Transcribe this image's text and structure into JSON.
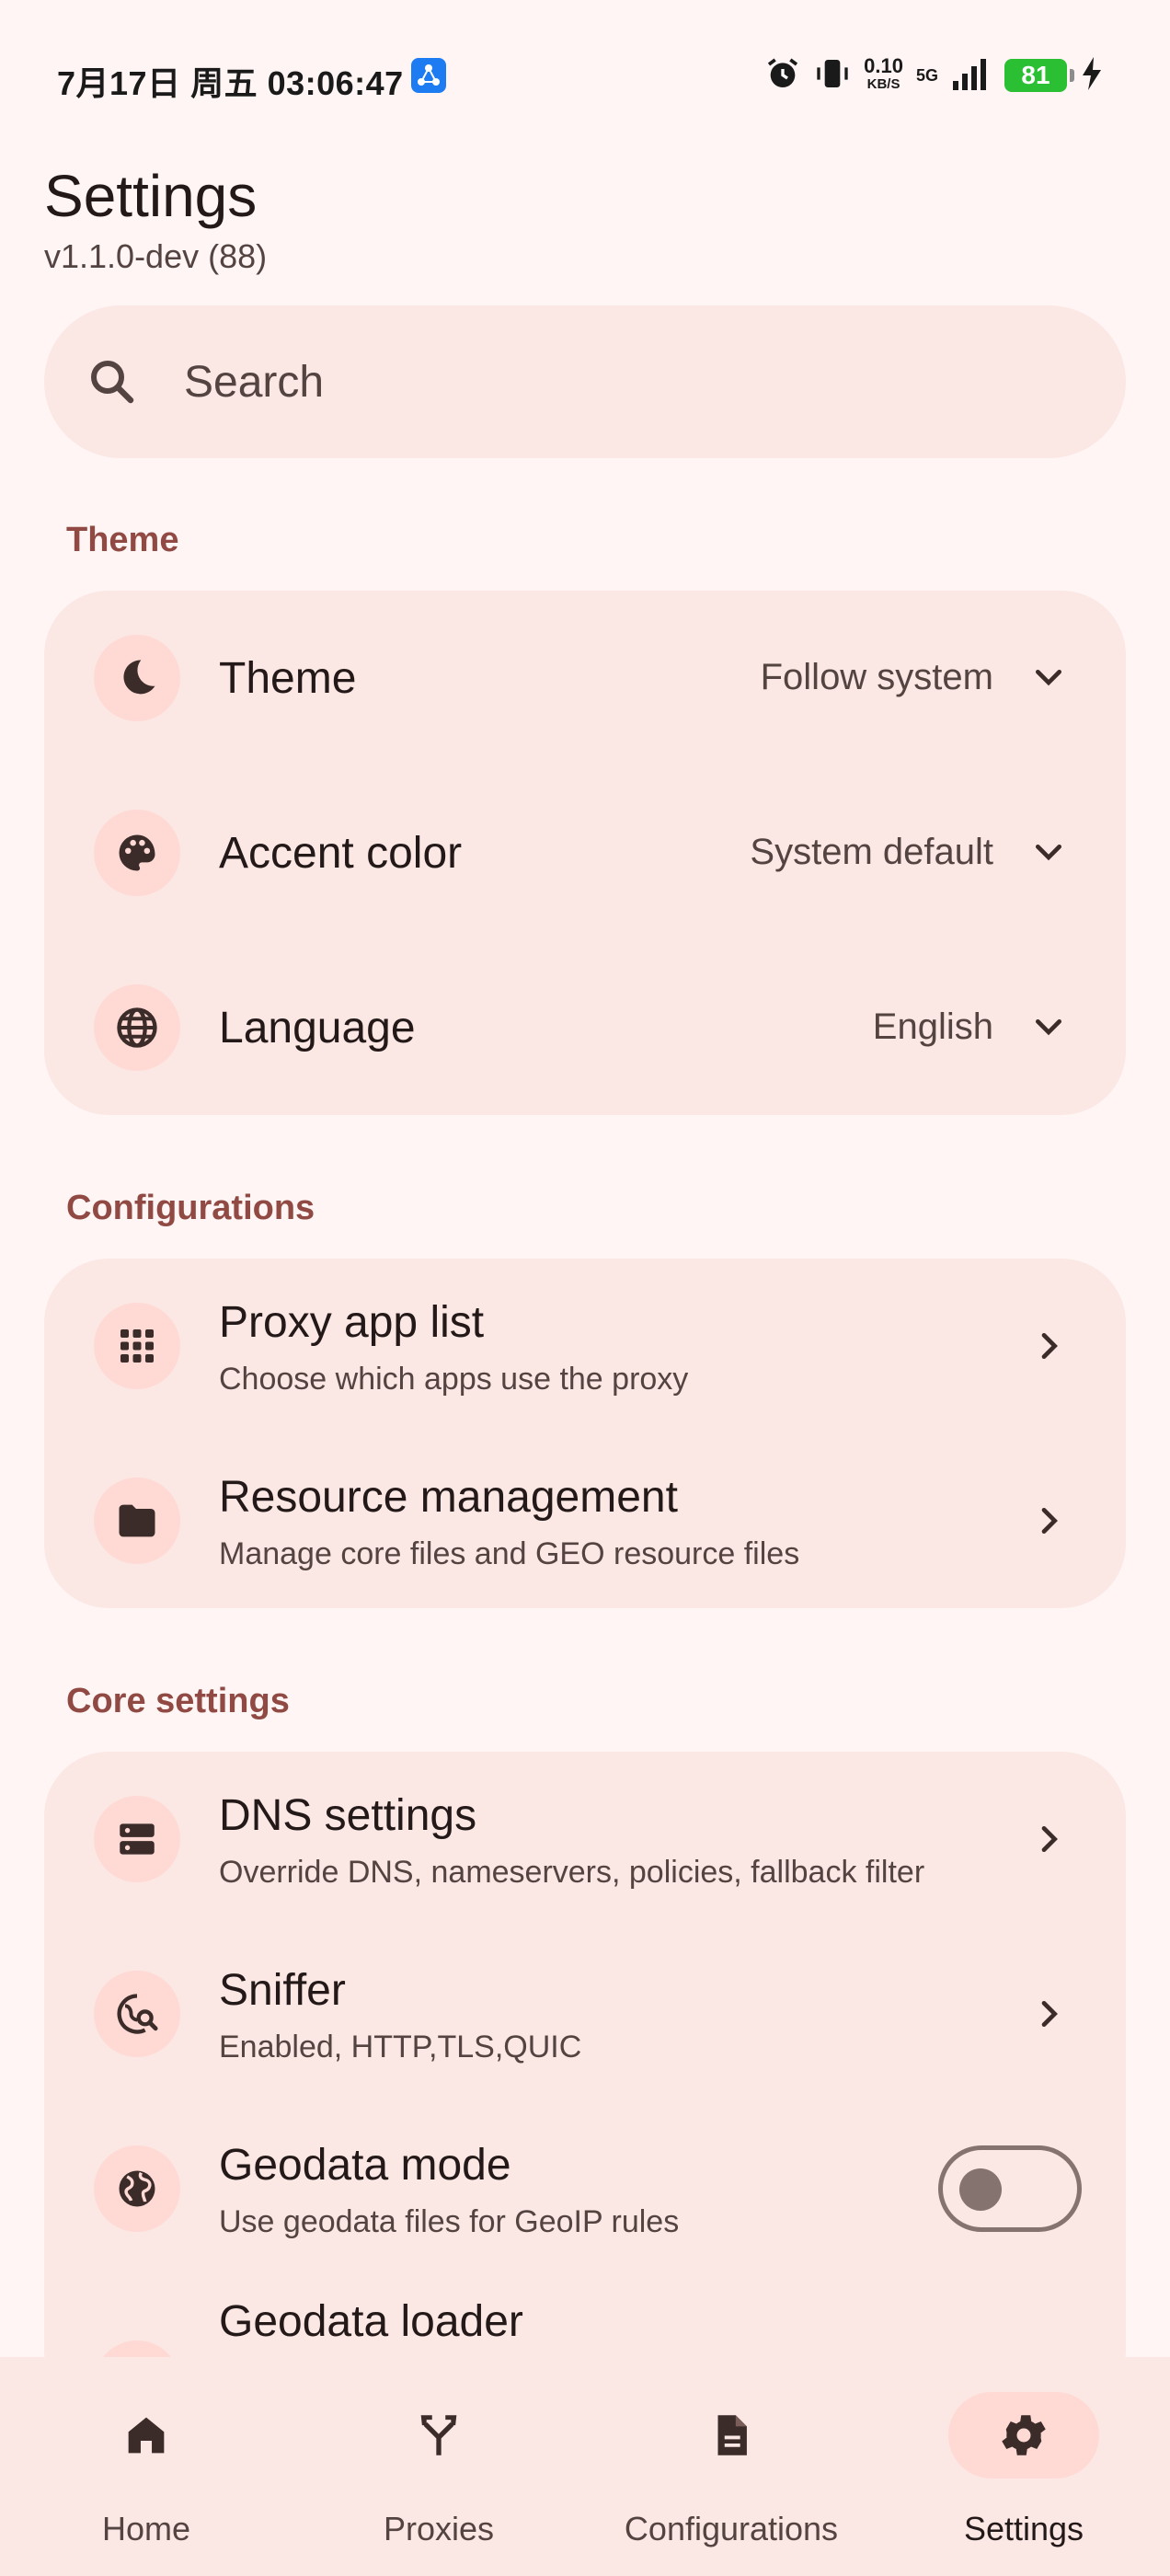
{
  "status_bar": {
    "time": "7月17日 周五 03:06:47",
    "speed_value": "0.10",
    "speed_unit": "KB/S",
    "network": "5G",
    "battery": "81"
  },
  "header": {
    "title": "Settings",
    "version": "v1.1.0-dev (88)"
  },
  "search": {
    "placeholder": "Search"
  },
  "sections": {
    "theme": {
      "label": "Theme",
      "items": [
        {
          "title": "Theme",
          "value": "Follow system",
          "icon": "dark-mode-icon"
        },
        {
          "title": "Accent color",
          "value": "System default",
          "icon": "palette-icon"
        },
        {
          "title": "Language",
          "value": "English",
          "icon": "globe-icon"
        }
      ]
    },
    "configurations": {
      "label": "Configurations",
      "items": [
        {
          "title": "Proxy app list",
          "subtitle": "Choose which apps use the proxy",
          "icon": "apps-grid-icon"
        },
        {
          "title": "Resource management",
          "subtitle": "Manage core files and GEO resource files",
          "icon": "folder-icon"
        }
      ]
    },
    "core": {
      "label": "Core settings",
      "items": [
        {
          "title": "DNS settings",
          "subtitle": "Override DNS, nameservers, policies, fallback filter",
          "icon": "dns-icon"
        },
        {
          "title": "Sniffer",
          "subtitle": "Enabled, HTTP,TLS,QUIC",
          "icon": "sniffer-icon"
        },
        {
          "title": "Geodata mode",
          "subtitle": "Use geodata files for GeoIP rules",
          "icon": "public-icon",
          "toggle": false
        },
        {
          "title": "Geodata loader",
          "icon": "loader-icon"
        }
      ]
    }
  },
  "bottom_nav": {
    "items": [
      {
        "label": "Home",
        "icon": "home-icon"
      },
      {
        "label": "Proxies",
        "icon": "fork-icon"
      },
      {
        "label": "Configurations",
        "icon": "document-icon"
      },
      {
        "label": "Settings",
        "icon": "gear-icon",
        "active": true
      }
    ]
  },
  "colors": {
    "background": "#fff5f4",
    "card": "#fbe7e4",
    "accent": "#904a43",
    "icon_container": "#ffdad5"
  }
}
